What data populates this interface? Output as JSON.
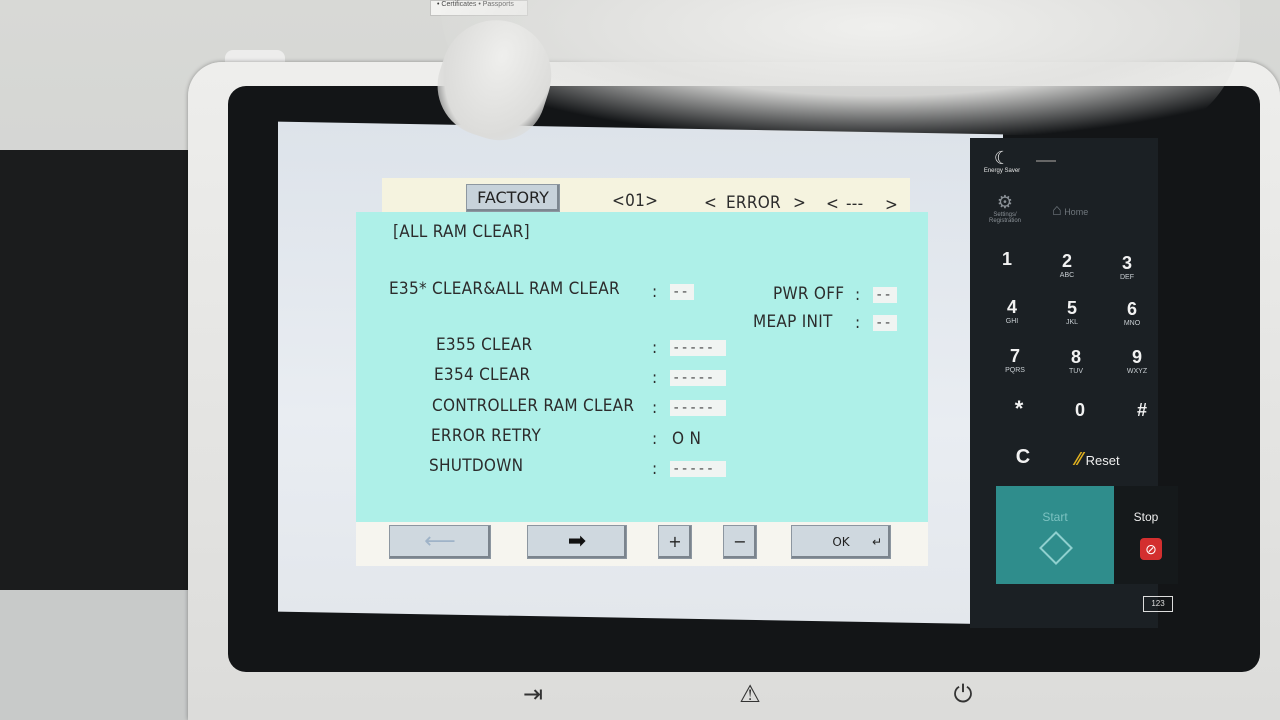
{
  "label_card": "• Certificates • Passports",
  "header": {
    "tab_factory": "FACTORY",
    "page_indicator": "<01>",
    "prev_category": "<",
    "category": "ERROR",
    "next_category": ">",
    "prev_item": "<",
    "item": "---",
    "next_item": ">"
  },
  "main": {
    "section_title": "[ALL RAM CLEAR]",
    "items": [
      {
        "label": "E35* CLEAR&ALL RAM CLEAR",
        "colon": ":",
        "value": "--"
      },
      {
        "label": "E355 CLEAR",
        "colon": ":",
        "value": "-----"
      },
      {
        "label": "E354 CLEAR",
        "colon": ":",
        "value": "-----"
      },
      {
        "label": "CONTROLLER RAM CLEAR",
        "colon": ":",
        "value": "-----"
      },
      {
        "label": "ERROR RETRY",
        "colon": ":",
        "value": "O N"
      },
      {
        "label": "SHUTDOWN",
        "colon": ":",
        "value": "-----"
      }
    ],
    "right_items": [
      {
        "label": "PWR OFF",
        "colon": ":",
        "value": "--"
      },
      {
        "label": "MEAP INIT",
        "colon": ":",
        "value": "--"
      }
    ]
  },
  "footer": {
    "back_glyph": "⟵",
    "forward_glyph": "➡",
    "plus": "+",
    "minus": "−",
    "ok": "OK",
    "ok_glyph": "↵"
  },
  "keypad": {
    "energy_saver": "Energy Saver",
    "settings_registration": "Settings/ Registration",
    "home": "Home",
    "keys": [
      {
        "n": "1",
        "s": ""
      },
      {
        "n": "2",
        "s": "ABC"
      },
      {
        "n": "3",
        "s": "DEF"
      },
      {
        "n": "4",
        "s": "GHI"
      },
      {
        "n": "5",
        "s": "JKL"
      },
      {
        "n": "6",
        "s": "MNO"
      },
      {
        "n": "7",
        "s": "PQRS"
      },
      {
        "n": "8",
        "s": "TUV"
      },
      {
        "n": "9",
        "s": "WXYZ"
      },
      {
        "n": "*",
        "s": ""
      },
      {
        "n": "0",
        "s": ""
      },
      {
        "n": "#",
        "s": ""
      }
    ],
    "clear": "C",
    "reset": "Reset",
    "start": "Start",
    "stop": "Stop",
    "counter": "123"
  },
  "colors": {
    "content_bg": "#aef0e8",
    "header_bg": "#f5f3df",
    "start_teal": "#2f8d8c",
    "stop_red": "#d32f2f",
    "reset_yellow": "#e0b020"
  },
  "bottom_icons": [
    "login-icon",
    "warning-icon",
    "power-icon"
  ]
}
